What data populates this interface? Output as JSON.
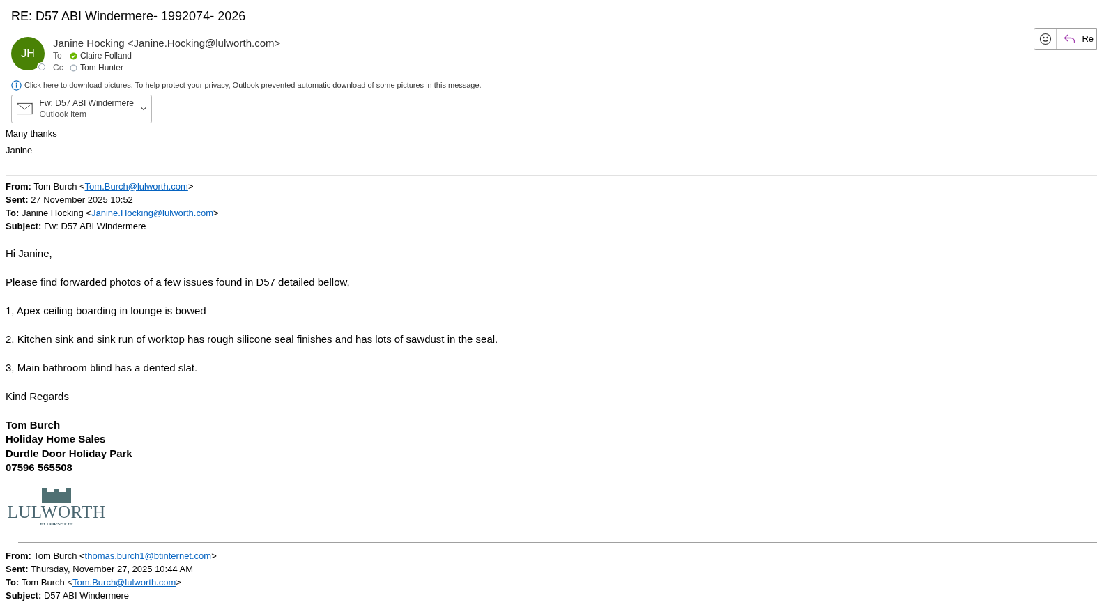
{
  "subject": "RE: D57 ABI Windermere- 1992074- 2026",
  "sender": {
    "initials": "JH",
    "name": "Janine Hocking",
    "email": "<Janine.Hocking@lulworth.com>"
  },
  "recipients": [
    {
      "label": "To",
      "name": "Claire Folland",
      "available": true
    },
    {
      "label": "Cc",
      "name": "Tom Hunter",
      "available": false
    }
  ],
  "toolbar": {
    "reply_label": "Re"
  },
  "info_bar": "Click here to download pictures. To help protect your privacy, Outlook prevented automatic download of some pictures in this message.",
  "attachment": {
    "name": "Fw: D57 ABI Windermere",
    "type": "Outlook item"
  },
  "reply_lines": [
    "Many thanks",
    "Janine"
  ],
  "quoted_1": {
    "headers": [
      {
        "label": "From:",
        "text": "Tom Burch <",
        "link": "Tom.Burch@lulworth.com",
        "after": ">"
      },
      {
        "label": "Sent:",
        "text": "27 November 2025 10:52"
      },
      {
        "label": "To:",
        "text": "Janine Hocking <",
        "link": "Janine.Hocking@lulworth.com",
        "after": ">"
      },
      {
        "label": "Subject:",
        "text": "Fw: D57 ABI Windermere"
      }
    ],
    "paragraphs": [
      "Hi Janine,",
      "Please find forwarded photos of a few issues found in D57 detailed bellow,",
      "1, Apex ceiling boarding in lounge is bowed",
      "2, Kitchen sink and sink run of worktop has rough silicone seal finishes and has lots of sawdust in the seal.",
      "3, Main bathroom blind has a dented slat.",
      "Kind Regards"
    ],
    "signature": [
      "Tom Burch",
      "Holiday Home Sales",
      "Durdle Door Holiday Park",
      "07596 565508"
    ],
    "logo": {
      "name": "LULWORTH",
      "subtitle": "••• DORSET •••"
    }
  },
  "quoted_2": {
    "headers": [
      {
        "label": "From:",
        "text": "Tom Burch <",
        "link": "thomas.burch1@btinternet.com",
        "after": ">"
      },
      {
        "label": "Sent:",
        "text": "Thursday, November 27, 2025 10:44 AM"
      },
      {
        "label": "To:",
        "text": "Tom Burch <",
        "link": "Tom.Burch@lulworth.com",
        "after": ">"
      },
      {
        "label": "Subject:",
        "text": "D57 ABI Windermere"
      }
    ]
  }
}
